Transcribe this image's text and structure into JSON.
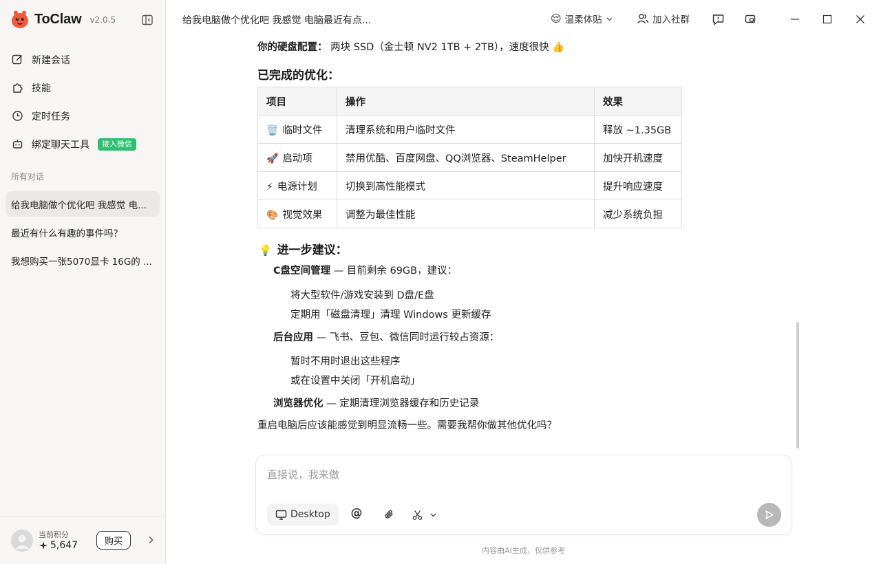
{
  "app": {
    "name": "ToClaw",
    "version": "v2.0.5"
  },
  "sidebar": {
    "nav": [
      {
        "label": "新建会话",
        "icon": "edit-icon"
      },
      {
        "label": "技能",
        "icon": "puzzle-icon"
      },
      {
        "label": "定时任务",
        "icon": "clock-icon"
      },
      {
        "label": "绑定聊天工具",
        "icon": "robot-icon",
        "badge": "接入微信"
      }
    ],
    "section_label": "所有对话",
    "conversations": [
      {
        "title": "给我电脑做个优化吧 我感觉 电...",
        "active": true
      },
      {
        "title": "最近有什么有趣的事件吗？",
        "active": false
      },
      {
        "title": "我想购买一张5070显卡 16G的 ...",
        "active": false
      }
    ],
    "footer": {
      "points_label": "当前积分",
      "points_value": "5,647",
      "buy_label": "购买"
    }
  },
  "topbar": {
    "title": "给我电脑做个优化吧 我感觉 电脑最近有点...",
    "mood_emoji": "😌",
    "mood_label": "温柔体贴",
    "community_label": "加入社群"
  },
  "message": {
    "disk_label": "你的硬盘配置：",
    "disk_value": "两块 SSD（金士顿 NV2 1TB + 2TB），速度很快 👍",
    "done_heading": "已完成的优化：",
    "table": {
      "headers": [
        "项目",
        "操作",
        "效果"
      ],
      "rows": [
        {
          "emoji": "🗑️",
          "item": "临时文件",
          "action": "清理系统和用户临时文件",
          "effect": "释放 ~1.35GB"
        },
        {
          "emoji": "🚀",
          "item": "启动项",
          "action": "禁用优酷、百度网盘、QQ浏览器、SteamHelper",
          "effect": "加快开机速度"
        },
        {
          "emoji": "⚡",
          "item": "电源计划",
          "action": "切换到高性能模式",
          "effect": "提升响应速度"
        },
        {
          "emoji": "🎨",
          "item": "视觉效果",
          "action": "调整为最佳性能",
          "effect": "减少系统负担"
        }
      ]
    },
    "suggest_emoji": "💡",
    "suggest_heading": "进一步建议：",
    "suggestions": [
      {
        "title": "C盘空间管理",
        "desc": " — 目前剩余 69GB，建议：",
        "subs": [
          "将大型软件/游戏安装到 D盘/E盘",
          "定期用「磁盘清理」清理 Windows 更新缓存"
        ]
      },
      {
        "title": "后台应用",
        "desc": " — 飞书、豆包、微信同时运行较占资源：",
        "subs": [
          "暂时不用时退出这些程序",
          "或在设置中关闭「开机启动」"
        ]
      },
      {
        "title": "浏览器优化",
        "desc": " — 定期清理浏览器缓存和历史记录",
        "subs": []
      }
    ],
    "closing": "重启电脑后应该能感觉到明显流畅一些。需要我帮你做其他优化吗？"
  },
  "composer": {
    "placeholder": "直接说，我来做",
    "mode_label": "Desktop",
    "at_symbol": "@"
  },
  "disclaimer": "内容由AI生成，仅供参考"
}
